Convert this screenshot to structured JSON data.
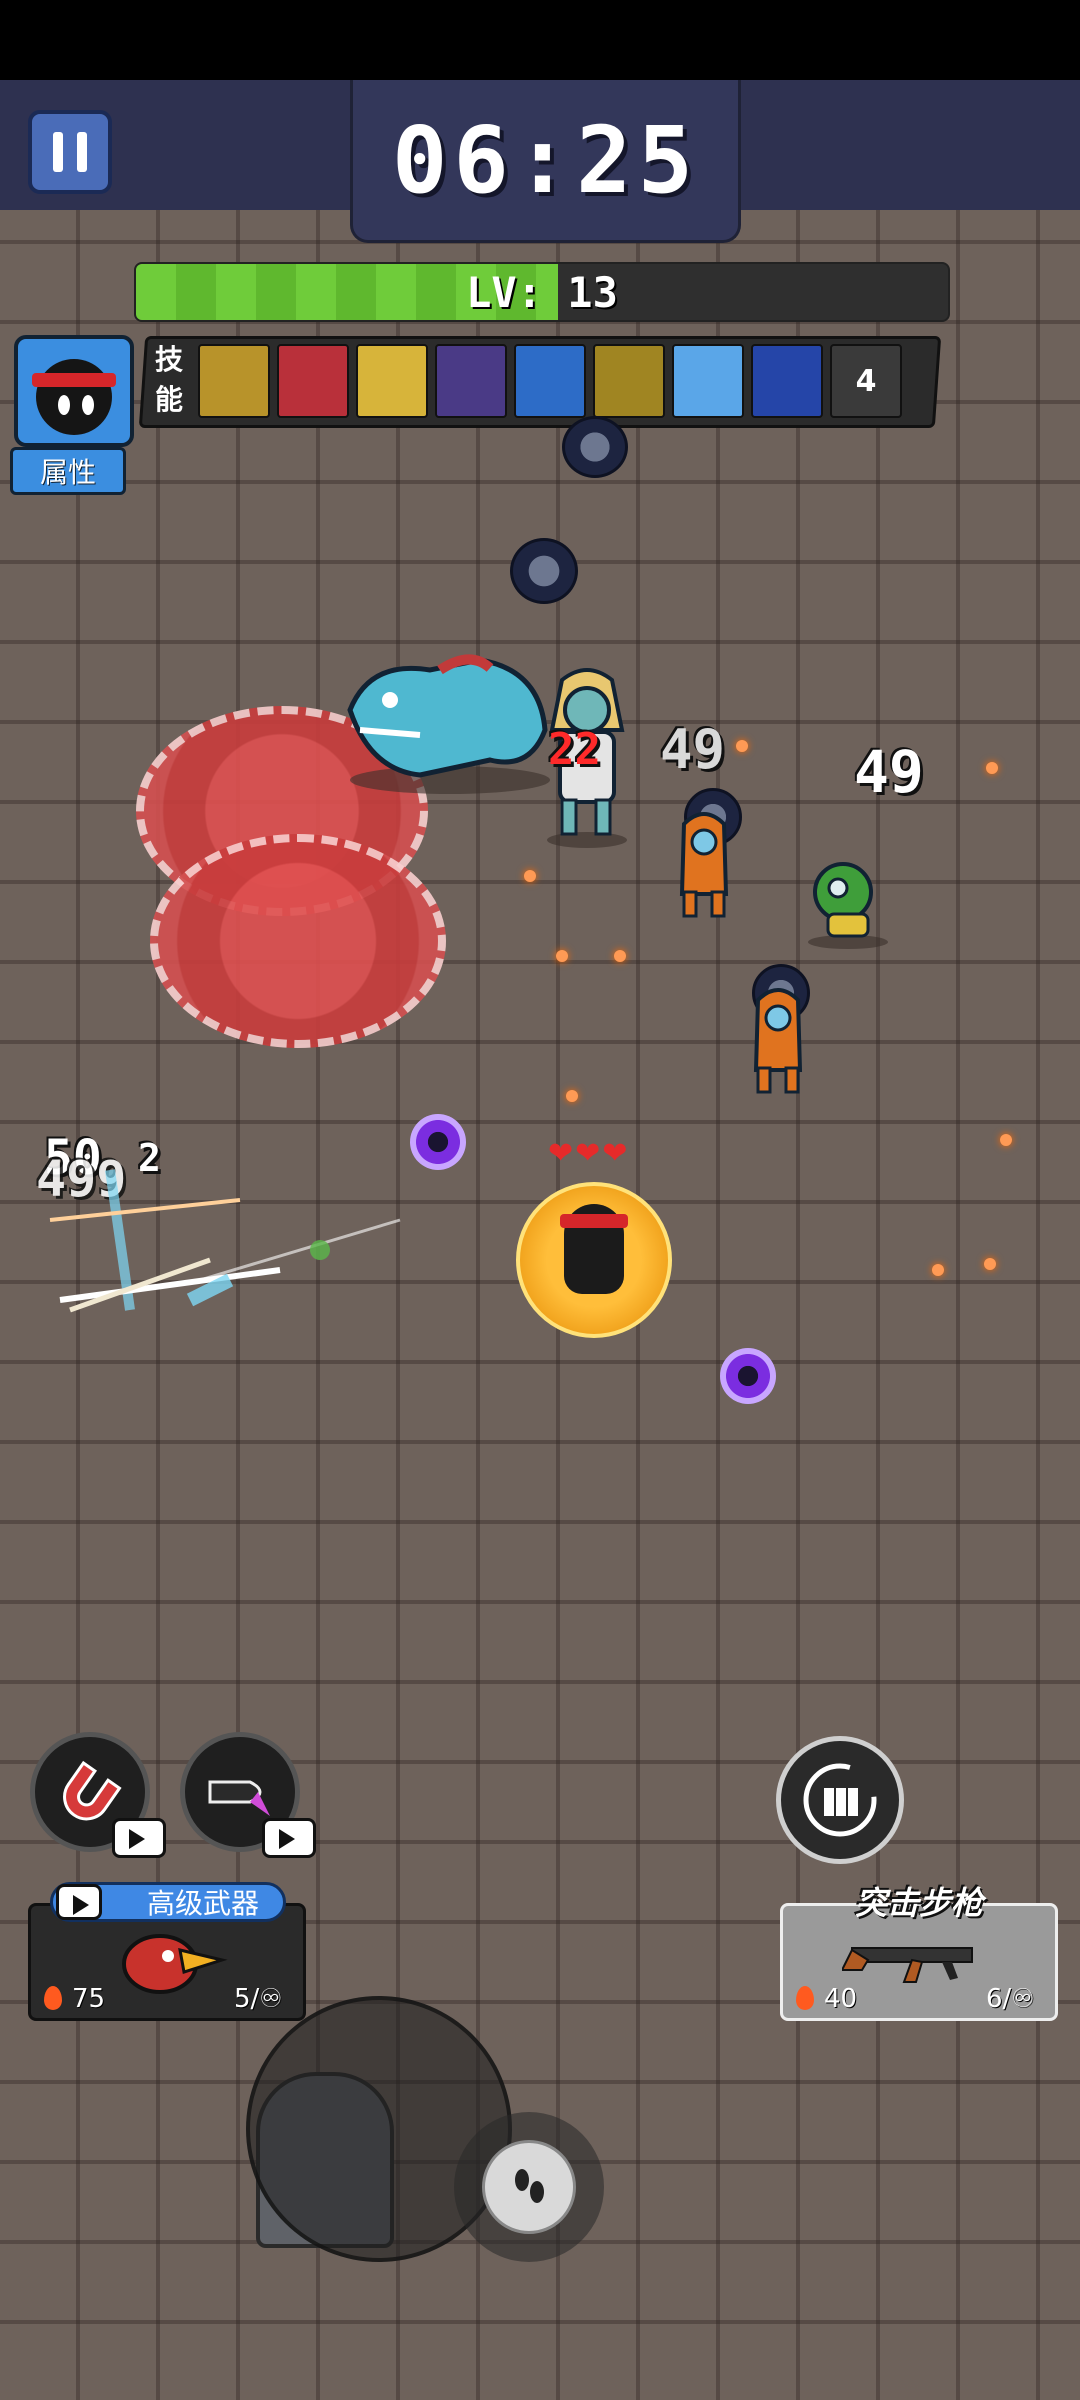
{
  "hud": {
    "timer": "06:25",
    "level_text": "LV: 13",
    "level_progress": 0.52,
    "skills_label_1": "技",
    "skills_label_2": "能",
    "attributes_label": "属性",
    "skills": [
      {
        "icon": "golden-spikes-icon",
        "color": "#b8932a"
      },
      {
        "icon": "red-demon-icon",
        "color": "#b9303a"
      },
      {
        "icon": "starburst-icon",
        "color": "#d7b43a"
      },
      {
        "icon": "purple-rune-icon",
        "color": "#4a3a86"
      },
      {
        "icon": "blue-shield-icon",
        "color": "#2d6cc7"
      },
      {
        "icon": "golden-arrows-icon",
        "color": "#a08522"
      },
      {
        "icon": "ice-wave-icon",
        "color": "#5aa6e8"
      },
      {
        "icon": "blue-shuriken-icon",
        "color": "#2545a8"
      },
      {
        "icon": "locked-skill-icon",
        "color": "#3a3a3a",
        "count": "4"
      }
    ]
  },
  "combat": {
    "damage_numbers": [
      "22",
      "49",
      "49",
      "50",
      "499",
      "2"
    ]
  },
  "bottom": {
    "advanced_weapon_label": "高级武器",
    "advanced_weapon_power": "75",
    "advanced_weapon_ammo": "5/♾",
    "rifle_label": "突击步枪",
    "rifle_power": "40",
    "rifle_ammo": "6/♾"
  },
  "colors": {
    "level_fill": "#6fcc3a",
    "accent_blue": "#3f88e4",
    "damage_red": "#ff2a2a"
  }
}
